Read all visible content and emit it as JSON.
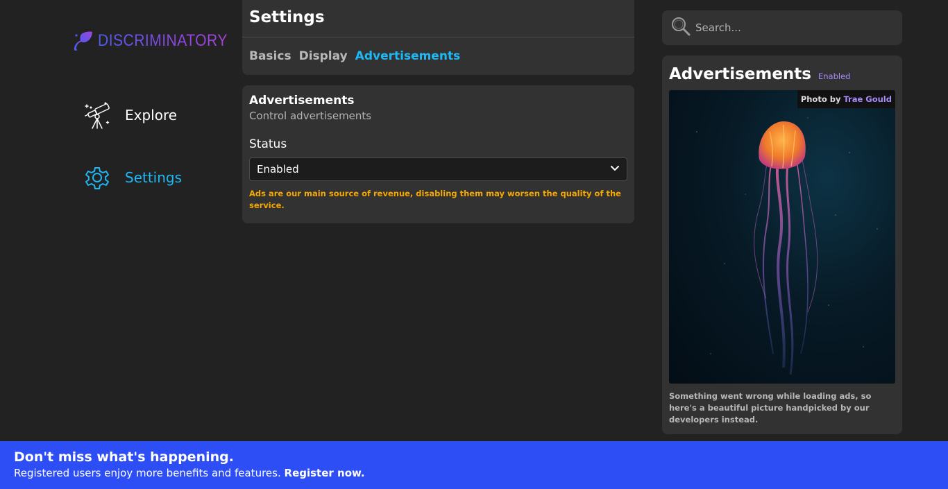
{
  "brand": {
    "name": "DISCRIMINATORY",
    "accent_start": "#4e5bf0",
    "accent_end": "#a442d8"
  },
  "nav": {
    "items": [
      {
        "label": "Explore",
        "icon": "telescope-icon"
      },
      {
        "label": "Settings",
        "icon": "gear-icon",
        "active": true
      }
    ]
  },
  "settings": {
    "title": "Settings",
    "tabs": [
      {
        "label": "Basics"
      },
      {
        "label": "Display"
      },
      {
        "label": "Advertisements",
        "active": true
      }
    ]
  },
  "ads_section": {
    "title": "Advertisements",
    "subtitle": "Control advertisements",
    "status_label": "Status",
    "status_value": "Enabled",
    "warning": "Ads are our main source of revenue, disabling them may worsen the quality of the service."
  },
  "search": {
    "placeholder": "Search...",
    "icon": "search-icon"
  },
  "ad_panel": {
    "title": "Advertisements",
    "badge": "Enabled",
    "credit_prefix": "Photo by",
    "credit_name": "Trae Gould",
    "caption": "Something went wrong while loading ads, so here's a beautiful picture handpicked by our developers instead."
  },
  "banner": {
    "title": "Don't miss what's happening.",
    "text": "Registered users enjoy more benefits and features.",
    "link": "Register now."
  },
  "colors": {
    "background": "#222222",
    "card": "#323232",
    "accent_blue": "#1eb8f5",
    "warning": "#f5a800",
    "banner": "#2d4ef5",
    "badge": "#a78bfa"
  }
}
